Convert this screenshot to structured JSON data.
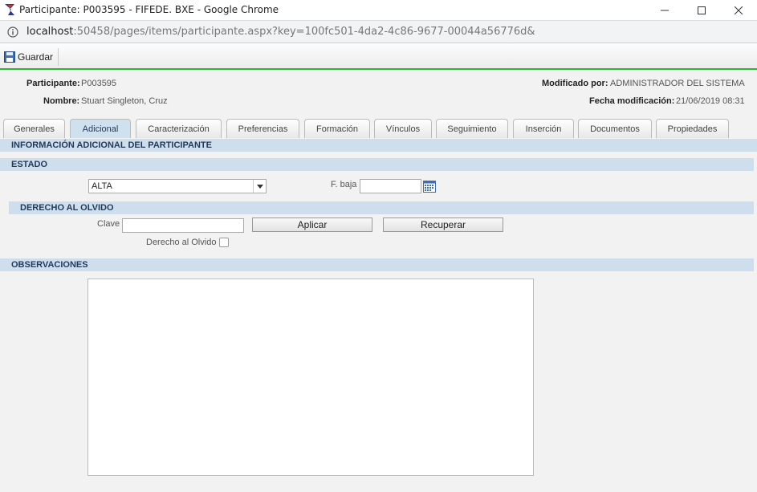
{
  "window": {
    "title": "Participante: P003595 - FIFEDE. BXE - Google Chrome",
    "url_host": "localhost",
    "url_path": ":50458/pages/items/participante.aspx?key=100fc501-4da2-4c86-9677-00044a56776d&"
  },
  "toolbar": {
    "save_label": "Guardar"
  },
  "header": {
    "participante_label": "Participante:",
    "participante_value": "P003595",
    "nombre_label": "Nombre:",
    "nombre_value": "Stuart Singleton, Cruz",
    "modificado_label": "Modificado por:",
    "modificado_value": "ADMINISTRADOR DEL SISTEMA",
    "fecha_label": "Fecha modificación:",
    "fecha_value": "21/06/2019 08:31"
  },
  "tabs": [
    "Generales",
    "Adicional",
    "Caracterización",
    "Preferencias",
    "Formación",
    "Vínculos",
    "Seguimiento",
    "Inserción",
    "Documentos",
    "Propiedades"
  ],
  "active_tab": "Adicional",
  "sections": {
    "info": "INFORMACIÓN ADICIONAL DEL PARTICIPANTE",
    "estado": "ESTADO",
    "derecho": "DERECHO AL OLVIDO",
    "observaciones": "OBSERVACIONES"
  },
  "estado": {
    "selected": "ALTA",
    "fbaja_label": "F. baja",
    "fbaja_value": ""
  },
  "derecho": {
    "clave_label": "Clave",
    "clave_value": "",
    "aplicar_label": "Aplicar",
    "recuperar_label": "Recuperar",
    "checkbox_label": "Derecho al Olvido",
    "checked": false
  },
  "observaciones": {
    "value": ""
  },
  "colors": {
    "accent_green": "#2eb82e",
    "section_bg": "#cfdeed",
    "section_text": "#1f3a5a"
  }
}
